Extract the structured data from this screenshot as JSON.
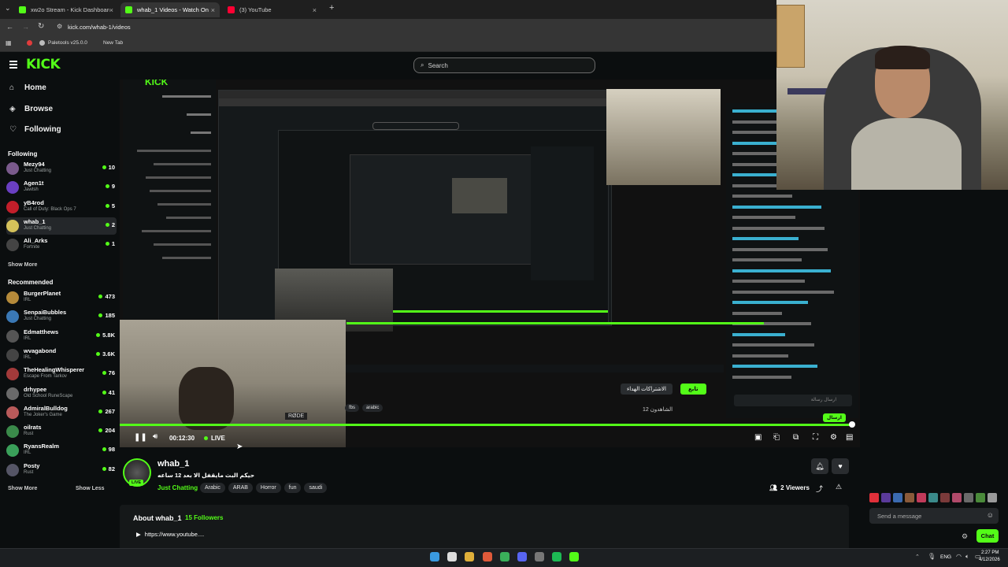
{
  "browser": {
    "tabs": [
      {
        "label": "xw2o Stream - Kick Dashboard",
        "fav_color": "#53fc18"
      },
      {
        "label": "whab_1 Videos - Watch On",
        "fav_color": "#53fc18"
      },
      {
        "label": "(3) YouTube",
        "fav_color": "#ff0033"
      }
    ],
    "url": "kick.com/whab-1/videos",
    "bookmarks": [
      "Paletools v25.0.0",
      "New Tab"
    ]
  },
  "header": {
    "logo": "KICK",
    "search_placeholder": "Search"
  },
  "sidebar": {
    "nav": [
      {
        "label": "Home",
        "icon": "home-icon"
      },
      {
        "label": "Browse",
        "icon": "compass-icon"
      },
      {
        "label": "Following",
        "icon": "heart-icon"
      }
    ],
    "following_title": "Following",
    "following": [
      {
        "name": "Mezy94",
        "category": "Just Chatting",
        "viewers": "10",
        "color": "#7a5a8c"
      },
      {
        "name": "Agen1t",
        "category": "Jawtsh",
        "viewers": "9",
        "color": "#6a3fc2"
      },
      {
        "name": "yB4rod",
        "category": "Call of Duty: Black Ops 7",
        "viewers": "5",
        "color": "#c21e2a"
      },
      {
        "name": "whab_1",
        "category": "Just Chatting",
        "viewers": "2",
        "color": "#d4c15a"
      },
      {
        "name": "Ali_Arks",
        "category": "Fortnite",
        "viewers": "1",
        "color": "#444"
      }
    ],
    "following_more": "Show More",
    "recommended_title": "Recommended",
    "recommended": [
      {
        "name": "BurgerPlanet",
        "category": "IRL",
        "viewers": "473",
        "color": "#b58a3a"
      },
      {
        "name": "SenpaiBubbles",
        "category": "Just Chatting",
        "viewers": "185",
        "color": "#3a78b5"
      },
      {
        "name": "Edmatthews",
        "category": "IRL",
        "viewers": "5.8K",
        "color": "#555"
      },
      {
        "name": "wvagabond",
        "category": "IRL",
        "viewers": "3.6K",
        "color": "#444"
      },
      {
        "name": "TheHealingWhisperer",
        "category": "Escape From Tarkov",
        "viewers": "76",
        "color": "#a23a3a"
      },
      {
        "name": "drhypee",
        "category": "Old School RuneScape",
        "viewers": "41",
        "color": "#6a6a6a"
      },
      {
        "name": "AdmiralBulldog",
        "category": "The Joker's Game",
        "viewers": "267",
        "color": "#b85a5a"
      },
      {
        "name": "oilrats",
        "category": "Rust",
        "viewers": "204",
        "color": "#3a8a4a"
      },
      {
        "name": "RyansRealm",
        "category": "IRL",
        "viewers": "98",
        "color": "#3aa05a"
      },
      {
        "name": "Posty",
        "category": "Rust",
        "viewers": "82",
        "color": "#556"
      }
    ],
    "show_more": "Show More",
    "show_less": "Show Less"
  },
  "player": {
    "time": "00:12:30",
    "live": "LIVE",
    "inner_viewers": "12 الشاهدون",
    "inner_subscribe": "الاشتراكات الهداء",
    "inner_follow": "تابع",
    "inner_tags": [
      "fbs",
      "arabic"
    ],
    "inner_chat_send": "ارسال",
    "inner_chat_placeholder": "ارسال رسالة"
  },
  "stream": {
    "channel": "whab_1",
    "title": "حيكم البث مايقفل الا بعد 12 ساعه",
    "category": "Just Chatting",
    "tags": [
      "Arabic",
      "ARAB",
      "Horror",
      "fun",
      "saudi"
    ],
    "viewers": "2 Viewers",
    "live_badge": "LIVE",
    "about_title": "About whab_1",
    "followers": "15 Followers",
    "link": "https://www.youtube...."
  },
  "chat": {
    "placeholder": "Send a message",
    "button": "Chat"
  },
  "taskbar": {
    "lang": "ENG",
    "time": "2:27 PM",
    "date": "4/12/2026"
  }
}
